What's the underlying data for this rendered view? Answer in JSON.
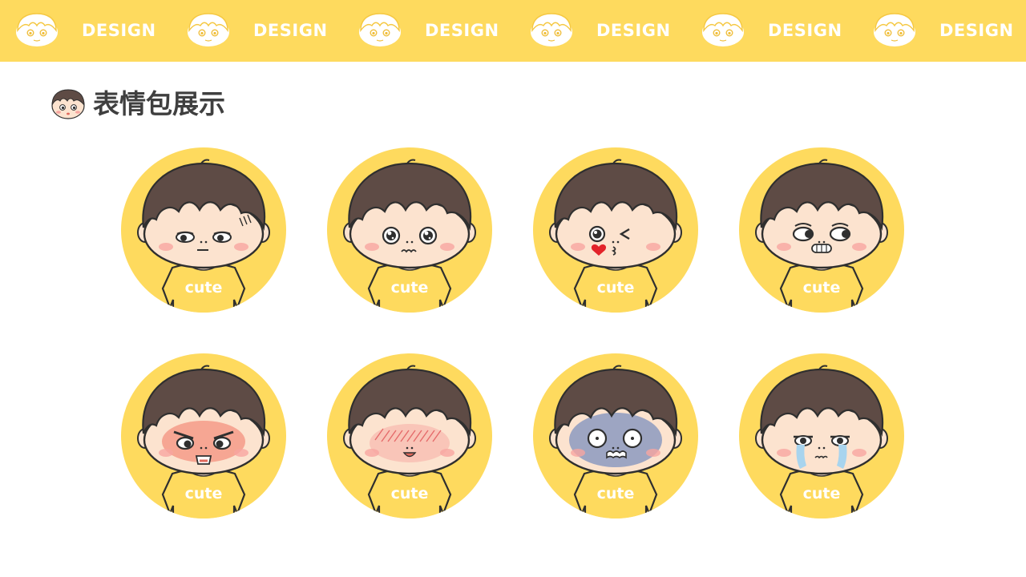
{
  "banner": {
    "text": "DESIGN",
    "background": "#FEDA5E",
    "text_color": "#FFFFFF",
    "repeat_count": 6
  },
  "title": {
    "text": "表情包展示",
    "color": "#3F3F3F",
    "icon": "boy-face-icon"
  },
  "palette": {
    "circle": "#FEDA5E",
    "shirt": "#FEDA5E",
    "hair": "#5E4B45",
    "skin": "#FCE3CF",
    "outline": "#2F2F2F",
    "blush": "#F7A5A0"
  },
  "stickers": [
    {
      "expression": "unimpressed",
      "shirt_text": "cute"
    },
    {
      "expression": "starry-eyed",
      "shirt_text": "cute"
    },
    {
      "expression": "wink-kiss",
      "shirt_text": "cute"
    },
    {
      "expression": "side-eye-grin",
      "shirt_text": "cute"
    },
    {
      "expression": "angry",
      "shirt_text": "cute"
    },
    {
      "expression": "blushing",
      "shirt_text": "cute"
    },
    {
      "expression": "shocked",
      "shirt_text": "cute"
    },
    {
      "expression": "crying",
      "shirt_text": "cute"
    }
  ]
}
